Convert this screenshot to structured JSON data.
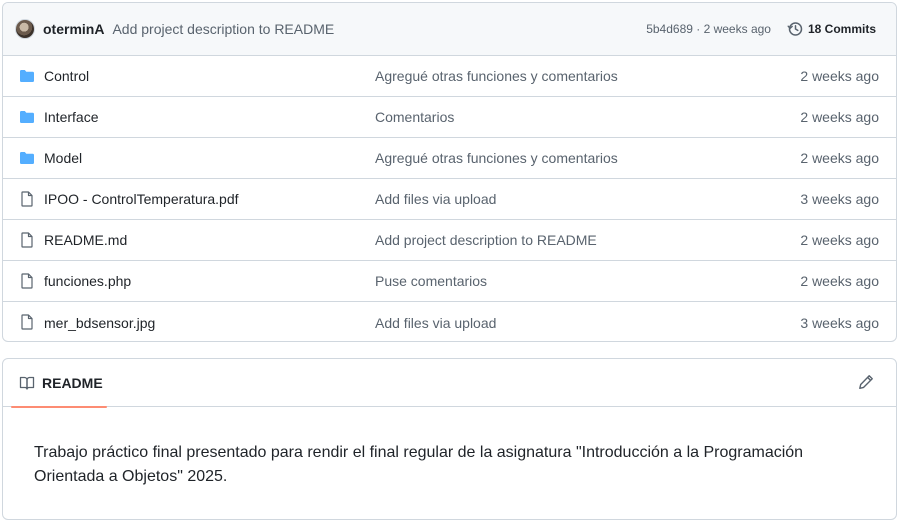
{
  "commit_bar": {
    "author": "oterminA",
    "message": "Add project description to README",
    "sha_time": "5b4d689 · 2 weeks ago",
    "commits_label": "18 Commits"
  },
  "files": [
    {
      "type": "folder",
      "name": "Control",
      "commit": "Agregué otras funciones y comentarios",
      "age": "2 weeks ago"
    },
    {
      "type": "folder",
      "name": "Interface",
      "commit": "Comentarios",
      "age": "2 weeks ago"
    },
    {
      "type": "folder",
      "name": "Model",
      "commit": "Agregué otras funciones y comentarios",
      "age": "2 weeks ago"
    },
    {
      "type": "file",
      "name": "IPOO - ControlTemperatura.pdf",
      "commit": "Add files via upload",
      "age": "3 weeks ago"
    },
    {
      "type": "file",
      "name": "README.md",
      "commit": "Add project description to README",
      "age": "2 weeks ago"
    },
    {
      "type": "file",
      "name": "funciones.php",
      "commit": "Puse comentarios",
      "age": "2 weeks ago"
    },
    {
      "type": "file",
      "name": "mer_bdsensor.jpg",
      "commit": "Add files via upload",
      "age": "3 weeks ago"
    }
  ],
  "readme": {
    "tab_label": "README",
    "body": "Trabajo práctico final presentado para rendir el final regular de la asignatura \"Introducción a la Programación Orientada a Objetos\" 2025."
  },
  "colors": {
    "folder": "#54aeff",
    "file_icon": "#59636e",
    "tab_underline": "#fd8c73"
  }
}
